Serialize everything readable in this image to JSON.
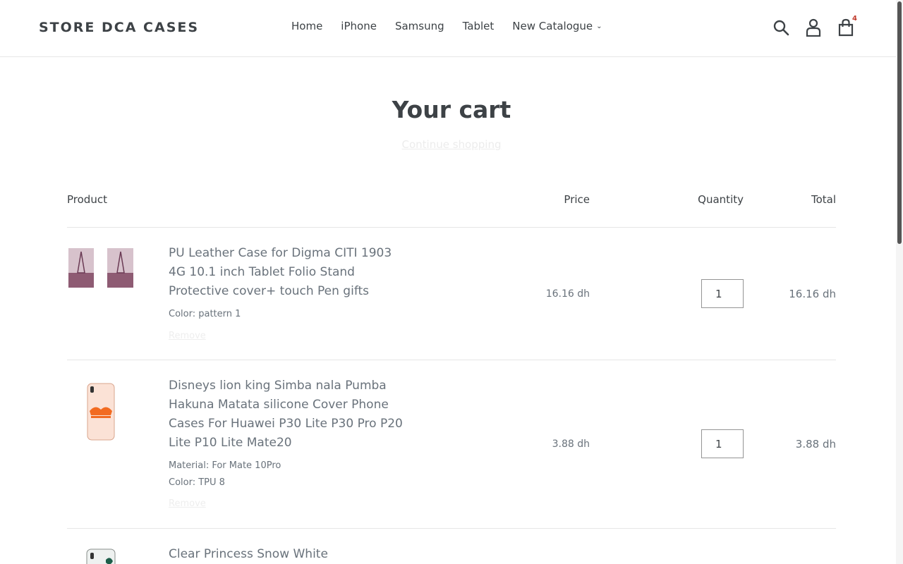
{
  "header": {
    "logo": "STORE DCA CASES",
    "nav": [
      {
        "label": "Home"
      },
      {
        "label": "iPhone"
      },
      {
        "label": "Samsung"
      },
      {
        "label": "Tablet"
      },
      {
        "label": "New Catalogue"
      }
    ],
    "icons": [
      "search-icon",
      "account-icon",
      "cart-icon"
    ],
    "cart_count": "4"
  },
  "page": {
    "title": "Your cart",
    "continue_link": "Continue shopping"
  },
  "table": {
    "headers": {
      "product": "Product",
      "price": "Price",
      "quantity": "Quantity",
      "total": "Total"
    },
    "items": [
      {
        "title": "PU Leather Case for Digma CITI 1903 4G 10.1 inch Tablet Folio Stand Protective cover+ touch Pen gifts",
        "options": [
          "Color: pattern 1"
        ],
        "remove": "Remove",
        "price": "16.16 dh",
        "quantity": "1",
        "total": "16.16 dh"
      },
      {
        "title": "Disneys lion king Simba nala Pumba Hakuna Matata silicone Cover Phone Cases For Huawei P30 Lite P30 Pro P20 Lite P10 Lite Mate20",
        "options": [
          "Material: For Mate 10Pro",
          "Color: TPU 8"
        ],
        "remove": "Remove",
        "price": "3.88 dh",
        "quantity": "1",
        "total": "3.88 dh"
      },
      {
        "title": "Clear Princess Snow White"
      }
    ]
  },
  "colors": {
    "text_dark": "#3d4246",
    "text_muted": "#69727b",
    "border": "#e6e6e6",
    "badge": "#c0392b"
  }
}
